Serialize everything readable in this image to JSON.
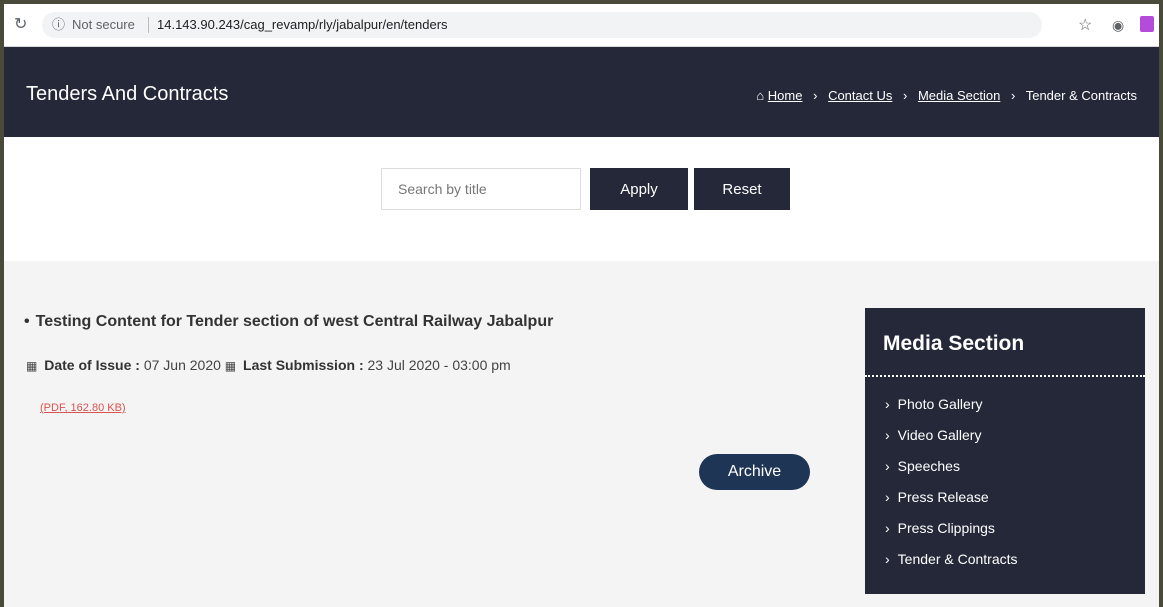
{
  "browser": {
    "reload_icon": "reload-icon",
    "info_icon": "info-icon",
    "security_label": "Not secure",
    "url": "14.143.90.243/cag_revamp/rly/jabalpur/en/tenders",
    "star_icon": "star-icon",
    "camera_icon": "camera-icon",
    "extension_icon": "extension-icon"
  },
  "header": {
    "title": "Tenders And Contracts",
    "breadcrumb": {
      "home": "Home",
      "contact": "Contact Us",
      "media": "Media Section",
      "current": "Tender & Contracts"
    }
  },
  "search": {
    "placeholder": "Search by title",
    "apply_label": "Apply",
    "reset_label": "Reset"
  },
  "tender": {
    "title": "Testing Content for Tender section of west Central Railway Jabalpur",
    "issue_label": "Date of Issue :",
    "issue_date": "07 Jun 2020",
    "submission_label": "Last Submission :",
    "submission_date": "23 Jul 2020 - 03:00 pm",
    "file_link": "(PDF, 162.80 KB)"
  },
  "archive_label": "Archive",
  "sidebar": {
    "title": "Media Section",
    "items": [
      {
        "label": "Photo Gallery"
      },
      {
        "label": "Video Gallery"
      },
      {
        "label": "Speeches"
      },
      {
        "label": "Press Release"
      },
      {
        "label": "Press Clippings"
      },
      {
        "label": "Tender & Contracts"
      }
    ]
  },
  "colors": {
    "header_bg": "#242838",
    "archive_bg": "#1e3556",
    "pdf_link": "#d9534f",
    "content_bg": "#f4f4f4"
  }
}
